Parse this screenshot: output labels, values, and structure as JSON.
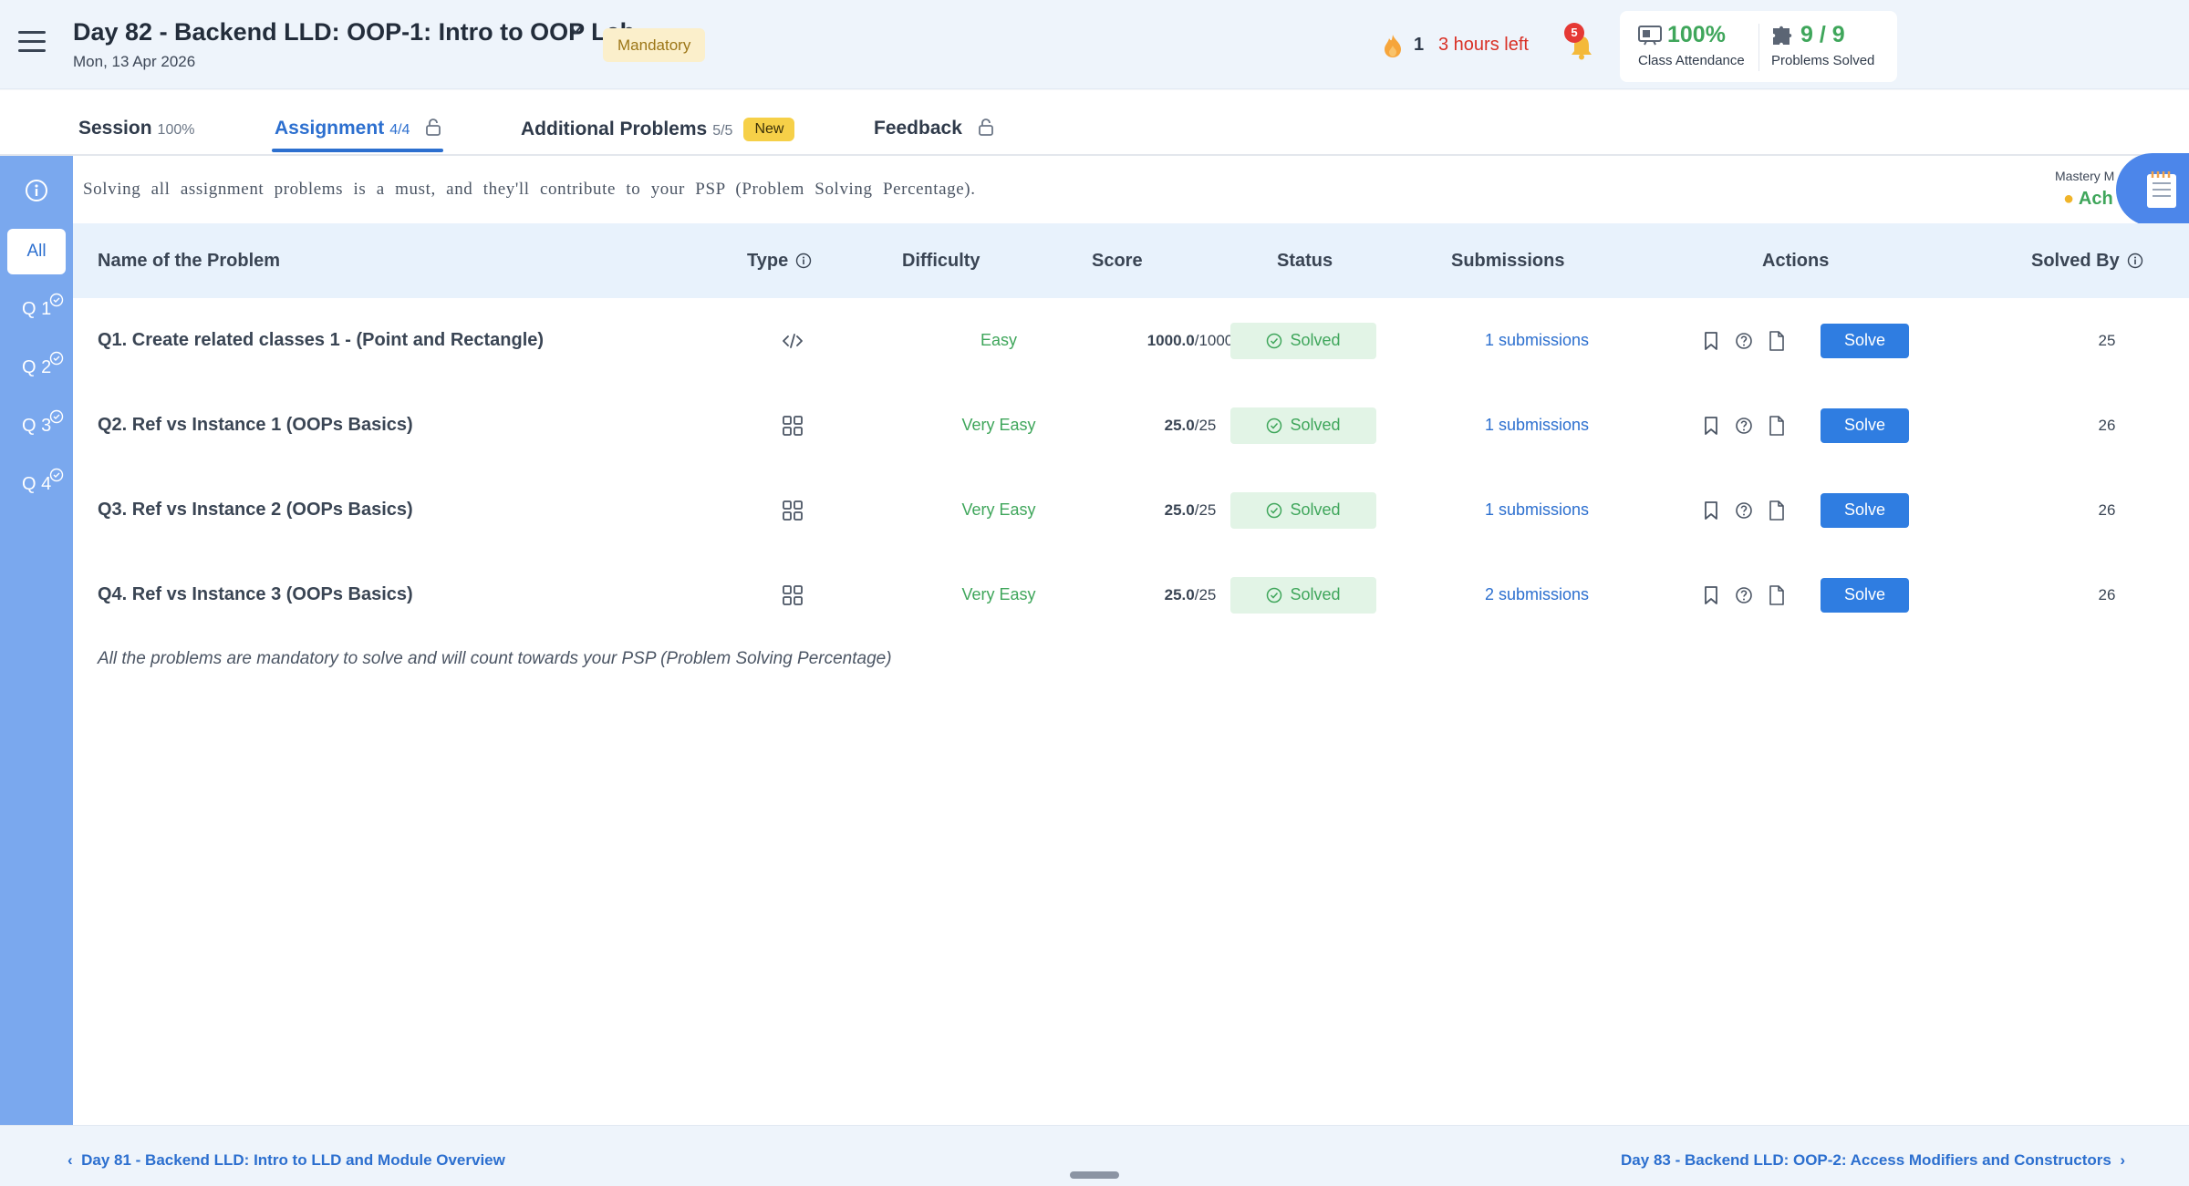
{
  "header": {
    "title": "Day 82 - Backend LLD: OOP-1: Intro to OOP Lab",
    "date": "Mon, 13 Apr 2026",
    "badge": "Mandatory",
    "streak_count": "1",
    "time_left": "3 hours left",
    "notification_count": "5",
    "attendance_value": "100%",
    "attendance_label": "Class Attendance",
    "problems_value": "9 / 9",
    "problems_label": "Problems Solved"
  },
  "tabs": [
    {
      "name": "Session",
      "count": "100%"
    },
    {
      "name": "Assignment",
      "count": "4/4"
    },
    {
      "name": "Additional Problems",
      "count": "5/5",
      "badge": "New"
    },
    {
      "name": "Feedback",
      "count": ""
    }
  ],
  "sidebar": {
    "all_label": "All",
    "items": [
      "Q 1",
      "Q 2",
      "Q 3",
      "Q 4"
    ]
  },
  "banner": {
    "text": "Solving all assignment problems is a must, and they'll contribute to your PSP (Problem Solving Percentage).",
    "mastery_label": "Mastery M",
    "mastery_value": "Ach"
  },
  "table": {
    "columns": [
      "Name of the Problem",
      "Type",
      "Difficulty",
      "Score",
      "Status",
      "Submissions",
      "Actions",
      "Solved By"
    ],
    "rows": [
      {
        "name": "Q1. Create related classes 1 - (Point and Rectangle)",
        "type_icon": "code-icon",
        "difficulty": "Easy",
        "score": "1000.0",
        "max": "/1000",
        "status": "Solved",
        "submissions": "1 submissions",
        "action": "Solve",
        "solved_by": "25"
      },
      {
        "name": "Q2. Ref vs Instance 1 (OOPs Basics)",
        "type_icon": "grid-icon",
        "difficulty": "Very Easy",
        "score": "25.0",
        "max": "/25",
        "status": "Solved",
        "submissions": "1 submissions",
        "action": "Solve",
        "solved_by": "26"
      },
      {
        "name": "Q3. Ref vs Instance 2 (OOPs Basics)",
        "type_icon": "grid-icon",
        "difficulty": "Very Easy",
        "score": "25.0",
        "max": "/25",
        "status": "Solved",
        "submissions": "1 submissions",
        "action": "Solve",
        "solved_by": "26"
      },
      {
        "name": "Q4. Ref vs Instance 3 (OOPs Basics)",
        "type_icon": "grid-icon",
        "difficulty": "Very Easy",
        "score": "25.0",
        "max": "/25",
        "status": "Solved",
        "submissions": "2 submissions",
        "action": "Solve",
        "solved_by": "26"
      }
    ],
    "footnote": "All the problems are mandatory to solve and will count towards your PSP (Problem Solving Percentage)"
  },
  "footer": {
    "prev": "Day 81 - Backend LLD: Intro to LLD and Module Overview",
    "next": "Day 83 - Backend LLD: OOP-2: Access Modifiers and Constructors"
  },
  "colors": {
    "accent": "#2c6fcf",
    "sidebar": "#7aa8ee",
    "success": "#3fa65b",
    "danger": "#d93025",
    "badge_yellow": "#f6d048"
  }
}
